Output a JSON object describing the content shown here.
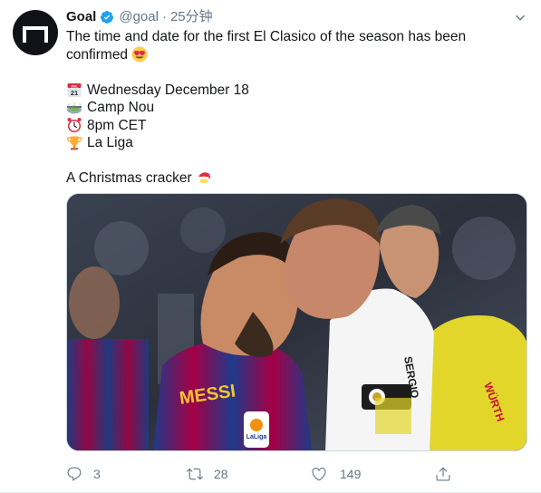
{
  "account": {
    "name": "Goal",
    "handle": "@goal",
    "separator": "·",
    "time": "25分钟",
    "verified": true
  },
  "tweet": {
    "text_line1": "The time and date for the first El Clasico of the season has been",
    "text_line2": "confirmed",
    "details": [
      {
        "icon": "calendar-icon",
        "text": "Wednesday December 18"
      },
      {
        "icon": "stadium-icon",
        "text": "Camp Nou"
      },
      {
        "icon": "alarm-clock-icon",
        "text": "8pm CET"
      },
      {
        "icon": "trophy-icon",
        "text": "La Liga"
      }
    ],
    "closing": "A Christmas cracker",
    "calendar_emoji_month": "JUL",
    "calendar_emoji_day": "21"
  },
  "media": {
    "shirt_text_left": "MESSI",
    "sleeve_badge": "LaLiga",
    "shirt_text_right": "SERGIO",
    "ref_shirt_text": "WÜRTH"
  },
  "actions": {
    "replies": "3",
    "retweets": "28",
    "likes": "149"
  },
  "colors": {
    "accent": "#1da1f2",
    "text": "#14171a",
    "muted": "#657786"
  }
}
